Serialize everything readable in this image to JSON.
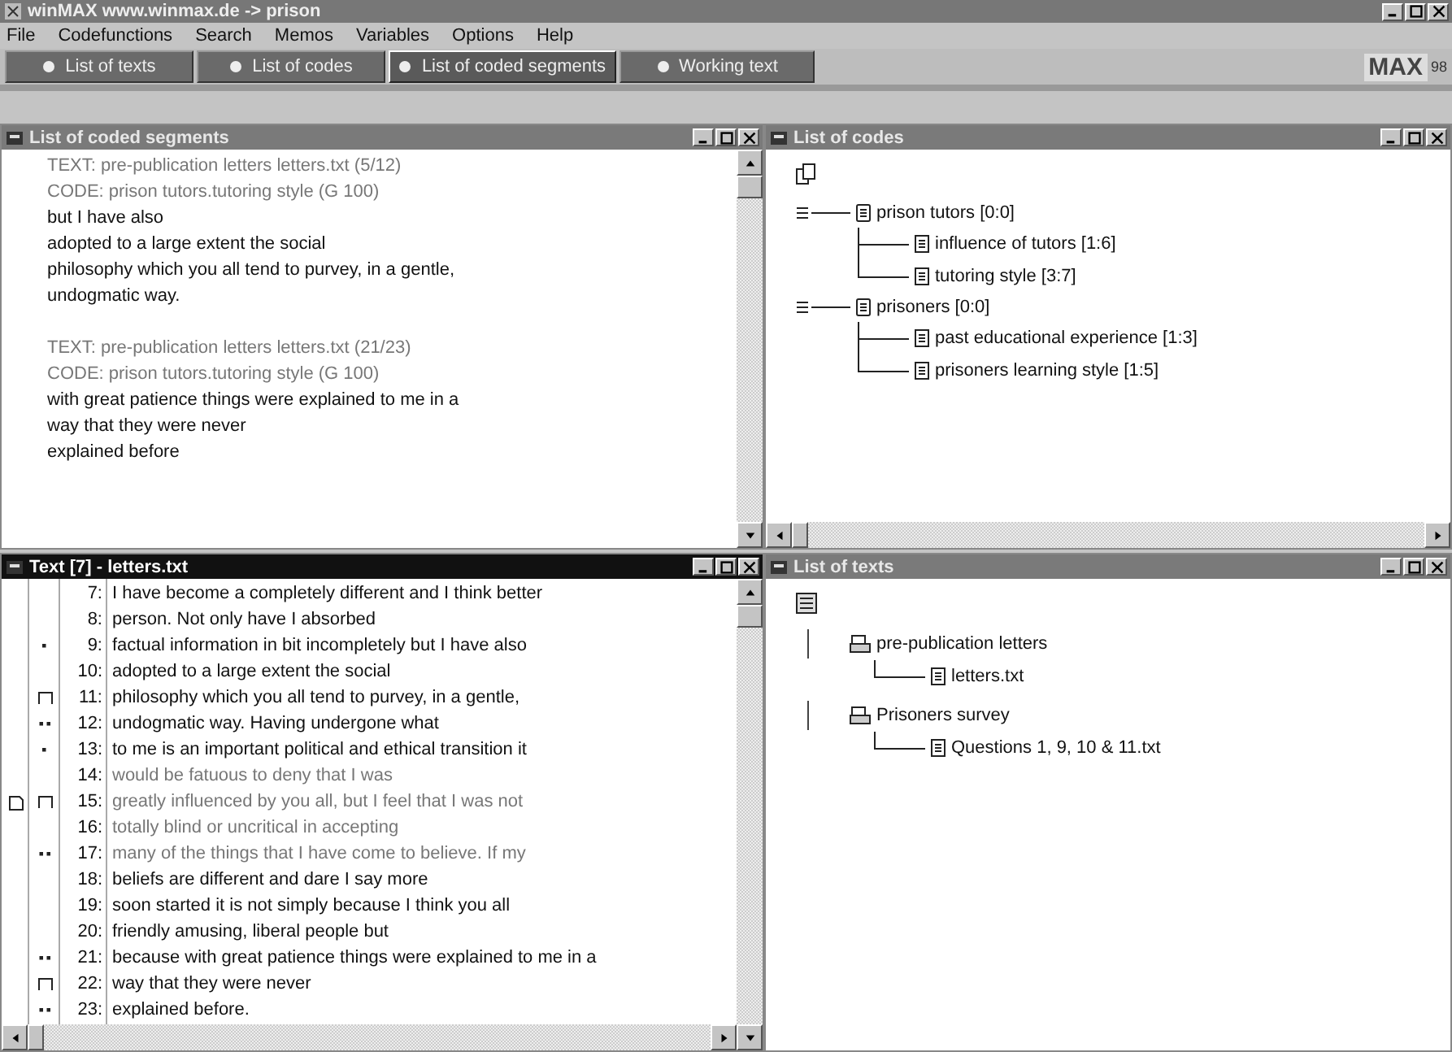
{
  "window": {
    "title": "winMAX www.winmax.de  -> prison",
    "logo": "MAX",
    "logo_version": "98"
  },
  "menu": [
    "File",
    "Codefunctions",
    "Search",
    "Memos",
    "Variables",
    "Options",
    "Help"
  ],
  "tabs": [
    {
      "label": "List of texts",
      "selected": false
    },
    {
      "label": "List of codes",
      "selected": false
    },
    {
      "label": "List of coded segments",
      "selected": true
    },
    {
      "label": "Working text",
      "selected": false
    }
  ],
  "coded_segments": {
    "title": "List of coded segments",
    "active": false,
    "lines": [
      {
        "kind": "header",
        "text": "TEXT: pre-publication letters letters.txt (5/12)"
      },
      {
        "kind": "header",
        "text": "CODE: prison tutors.tutoring style (G 100)"
      },
      {
        "kind": "body",
        "text": "but I have also"
      },
      {
        "kind": "body",
        "text": "adopted to a large extent the social"
      },
      {
        "kind": "body",
        "text": "philosophy which you all tend to purvey, in a gentle,"
      },
      {
        "kind": "body",
        "text": "undogmatic way."
      },
      {
        "kind": "gap"
      },
      {
        "kind": "header",
        "text": "TEXT: pre-publication letters letters.txt (21/23)"
      },
      {
        "kind": "header",
        "text": "CODE: prison tutors.tutoring style (G 100)"
      },
      {
        "kind": "body",
        "text": "with great patience things were explained to me in a"
      },
      {
        "kind": "body",
        "text": "way that they were never"
      },
      {
        "kind": "body",
        "text": "explained before"
      }
    ]
  },
  "codes": {
    "title": "List of codes",
    "active": false,
    "items": [
      {
        "label": "prison tutors [0:0]",
        "expanded": true,
        "children": [
          {
            "label": "influence of tutors [1:6]"
          },
          {
            "label": "tutoring style [3:7]"
          }
        ]
      },
      {
        "label": "prisoners [0:0]",
        "expanded": true,
        "children": [
          {
            "label": "past educational experience [1:3]"
          },
          {
            "label": "prisoners learning style [1:5]"
          }
        ]
      }
    ]
  },
  "text_window": {
    "title": "Text [7] - letters.txt",
    "active": true,
    "lines": [
      {
        "number": "7:",
        "text": "I have become a completely different and I think better",
        "coded": false
      },
      {
        "number": "8:",
        "text": "person. Not only have I absorbed",
        "coded": false
      },
      {
        "number": "9:",
        "text": "factual information in bit incompletely but I have also",
        "coded": false,
        "kind": "dot"
      },
      {
        "number": "10:",
        "text": "adopted to a large extent the social",
        "coded": false
      },
      {
        "number": "11:",
        "text": "philosophy which you all tend to purvey, in a gentle,",
        "coded": false,
        "kind": "bracket"
      },
      {
        "number": "12:",
        "text": "undogmatic way. Having undergone what",
        "coded": false,
        "kind": "dots"
      },
      {
        "number": "13:",
        "text": "to me is an important political and ethical transition it",
        "coded": false,
        "kind": "dot"
      },
      {
        "number": "14:",
        "text": "would be fatuous to deny that I was",
        "coded": true
      },
      {
        "number": "15:",
        "text": "greatly influenced by you all, but I feel that I was not",
        "coded": true,
        "kind": "bracket",
        "memo": true
      },
      {
        "number": "16:",
        "text": "totally blind or uncritical in accepting",
        "coded": true
      },
      {
        "number": "17:",
        "text": "many of the things that I have come to believe. If my",
        "coded": true,
        "kind": "dots"
      },
      {
        "number": "18:",
        "text": "beliefs are different and dare I say more",
        "coded": false
      },
      {
        "number": "19:",
        "text": "soon started it is not simply because I think you all",
        "coded": false
      },
      {
        "number": "20:",
        "text": "friendly amusing, liberal people but",
        "coded": false
      },
      {
        "number": "21:",
        "text": "because with great patience things were explained to me in a",
        "coded": false,
        "kind": "dots"
      },
      {
        "number": "22:",
        "text": "way that they were never",
        "coded": false,
        "kind": "bracket"
      },
      {
        "number": "23:",
        "text": "explained before.",
        "coded": false,
        "kind": "dots"
      }
    ]
  },
  "texts": {
    "title": "List of texts",
    "active": false,
    "groups": [
      {
        "label": "pre-publication letters",
        "children": [
          {
            "label": "letters.txt"
          }
        ]
      },
      {
        "label": "Prisoners survey",
        "children": [
          {
            "label": "Questions 1, 9, 10 & 11.txt"
          }
        ]
      }
    ]
  }
}
